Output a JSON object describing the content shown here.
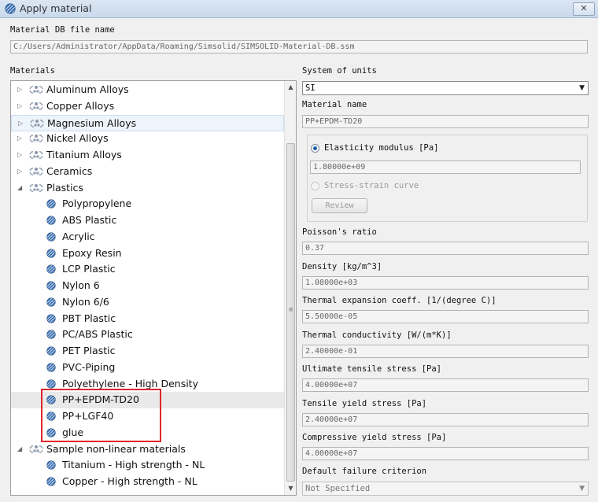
{
  "window": {
    "title": "Apply material",
    "close_glyph": "✕"
  },
  "db": {
    "label": "Material DB file name",
    "path": "C:/Users/Administrator/AppData/Roaming/Simsolid/SIMSOLID-Material-DB.ssm"
  },
  "materials": {
    "label": "Materials",
    "rows": [
      {
        "label": "Aluminum Alloys",
        "type": "folder",
        "depth": 0,
        "expanded": false
      },
      {
        "label": "Copper Alloys",
        "type": "folder",
        "depth": 0,
        "expanded": false
      },
      {
        "label": "Magnesium Alloys",
        "type": "folder",
        "depth": 0,
        "expanded": false,
        "state": "hover"
      },
      {
        "label": "Nickel Alloys",
        "type": "folder",
        "depth": 0,
        "expanded": false
      },
      {
        "label": "Titanium Alloys",
        "type": "folder",
        "depth": 0,
        "expanded": false
      },
      {
        "label": "Ceramics",
        "type": "folder",
        "depth": 0,
        "expanded": false
      },
      {
        "label": "Plastics",
        "type": "folder",
        "depth": 0,
        "expanded": true
      },
      {
        "label": "Polypropylene",
        "type": "material",
        "depth": 1
      },
      {
        "label": "ABS Plastic",
        "type": "material",
        "depth": 1
      },
      {
        "label": "Acrylic",
        "type": "material",
        "depth": 1
      },
      {
        "label": "Epoxy Resin",
        "type": "material",
        "depth": 1
      },
      {
        "label": "LCP Plastic",
        "type": "material",
        "depth": 1
      },
      {
        "label": "Nylon 6",
        "type": "material",
        "depth": 1
      },
      {
        "label": "Nylon 6/6",
        "type": "material",
        "depth": 1
      },
      {
        "label": "PBT Plastic",
        "type": "material",
        "depth": 1
      },
      {
        "label": "PC/ABS Plastic",
        "type": "material",
        "depth": 1
      },
      {
        "label": "PET Plastic",
        "type": "material",
        "depth": 1
      },
      {
        "label": "PVC-Piping",
        "type": "material",
        "depth": 1
      },
      {
        "label": "Polyethylene - High Density",
        "type": "material",
        "depth": 1
      },
      {
        "label": "PP+EPDM-TD20",
        "type": "material",
        "depth": 1,
        "state": "selected"
      },
      {
        "label": "PP+LGF40",
        "type": "material",
        "depth": 1
      },
      {
        "label": "glue",
        "type": "material",
        "depth": 1
      },
      {
        "label": "Sample non-linear materials",
        "type": "folder",
        "depth": 0,
        "expanded": true
      },
      {
        "label": "Titanium - High strength - NL",
        "type": "material",
        "depth": 1
      },
      {
        "label": "Copper - High strength - NL",
        "type": "material",
        "depth": 1
      }
    ]
  },
  "props": {
    "units_label": "System of units",
    "units_value": "SI",
    "name_label": "Material name",
    "name_value": "PP+EPDM-TD20",
    "elasticity_label": "Elasticity modulus [Pa]",
    "elasticity_value": "1.80000e+09",
    "stress_strain_label": "Stress-strain curve",
    "review_label": "Review",
    "fields": [
      {
        "label": "Poisson's ratio",
        "value": "0.37"
      },
      {
        "label": "Density [kg/m^3]",
        "value": "1.08000e+03"
      },
      {
        "label": "Thermal expansion coeff. [1/(degree C)]",
        "value": "5.50000e-05"
      },
      {
        "label": "Thermal conductivity [W/(m*K)]",
        "value": "2.40000e-01"
      },
      {
        "label": "Ultimate tensile stress [Pa]",
        "value": "4.00000e+07"
      },
      {
        "label": "Tensile yield stress [Pa]",
        "value": "2.40000e+07"
      },
      {
        "label": "Compressive yield stress [Pa]",
        "value": "4.00000e+07"
      }
    ],
    "failure_label": "Default failure criterion",
    "failure_value": "Not Specified"
  },
  "colors": {
    "highlight": "#e0262a",
    "material_icon": "#3a6fb0",
    "folder_icon": "#8a97aa"
  },
  "icons": {
    "folder": "atom-folder-icon",
    "material": "hatched-disc-icon",
    "expanded": "triangle-down-icon",
    "collapsed": "triangle-right-icon"
  }
}
